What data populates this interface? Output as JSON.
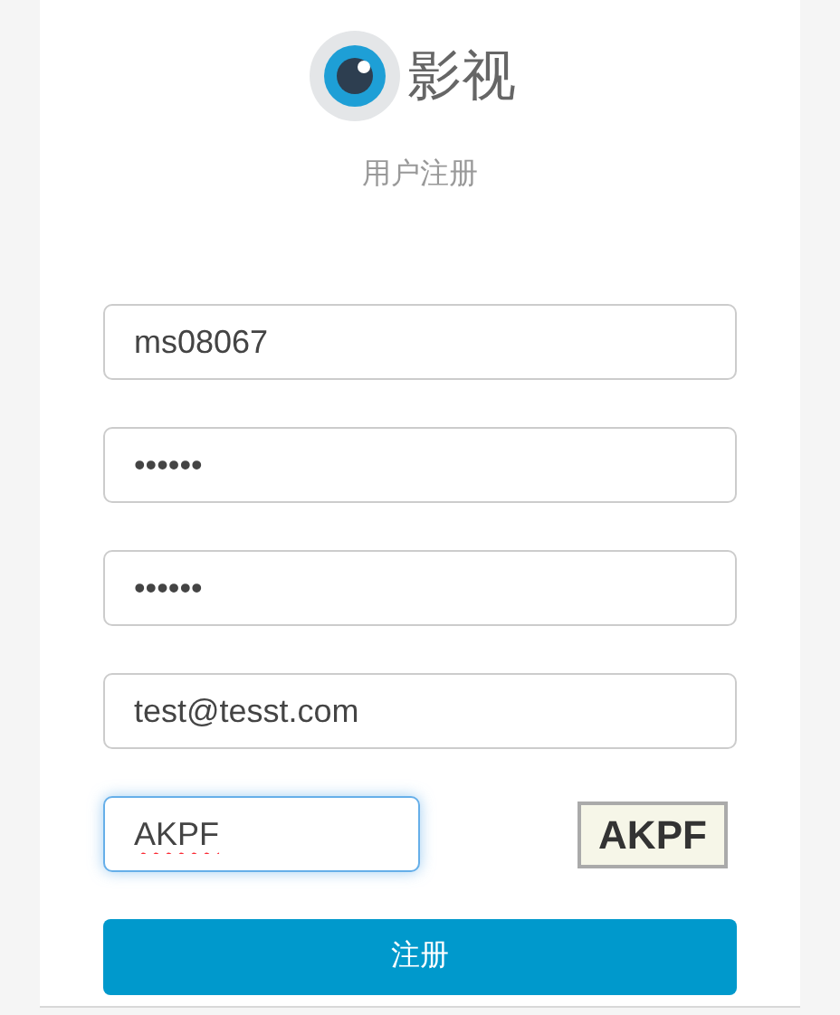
{
  "logo": {
    "text": "影视"
  },
  "title": "用户注册",
  "fields": [
    {
      "value": "ms08067",
      "focused": false,
      "misspelled": false
    },
    {
      "value": "••••••",
      "focused": false,
      "misspelled": false
    },
    {
      "value": "••••••",
      "focused": false,
      "misspelled": false
    },
    {
      "value": "test@tesst.com",
      "focused": false,
      "misspelled": false
    }
  ],
  "captcha": {
    "value": "AKPF",
    "focused": true,
    "misspelled": true,
    "image_text": "AKPF"
  },
  "submit": "注册"
}
